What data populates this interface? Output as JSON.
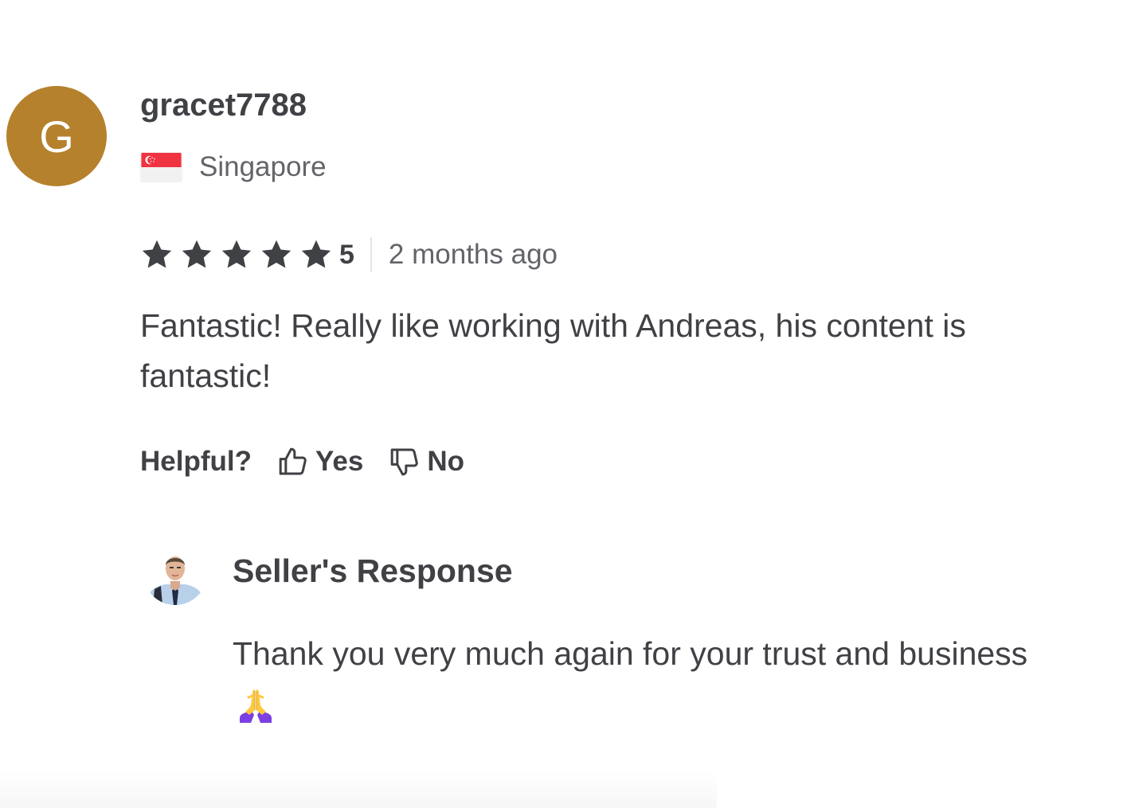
{
  "reviewer": {
    "avatar_initial": "G",
    "avatar_color": "#b5812c",
    "username": "gracet7788",
    "country": "Singapore",
    "flag_icon": "singapore-flag-icon"
  },
  "rating": {
    "stars_filled": 5,
    "stars_total": 5,
    "star_icon": "star-icon",
    "value": "5",
    "time_ago": "2 months ago"
  },
  "review": {
    "text": "Fantastic! Really like working with Andreas, his content is fantastic!"
  },
  "helpful": {
    "label": "Helpful?",
    "yes_label": "Yes",
    "yes_icon": "thumbs-up-icon",
    "no_label": "No",
    "no_icon": "thumbs-down-icon"
  },
  "seller_response": {
    "title": "Seller's Response",
    "text": "Thank you very much again for your trust and business",
    "emoji_icon": "folded-hands-emoji-icon"
  },
  "colors": {
    "text_primary": "#404145",
    "text_secondary": "#62646a",
    "star": "#404145",
    "divider": "#e4e5e7"
  }
}
